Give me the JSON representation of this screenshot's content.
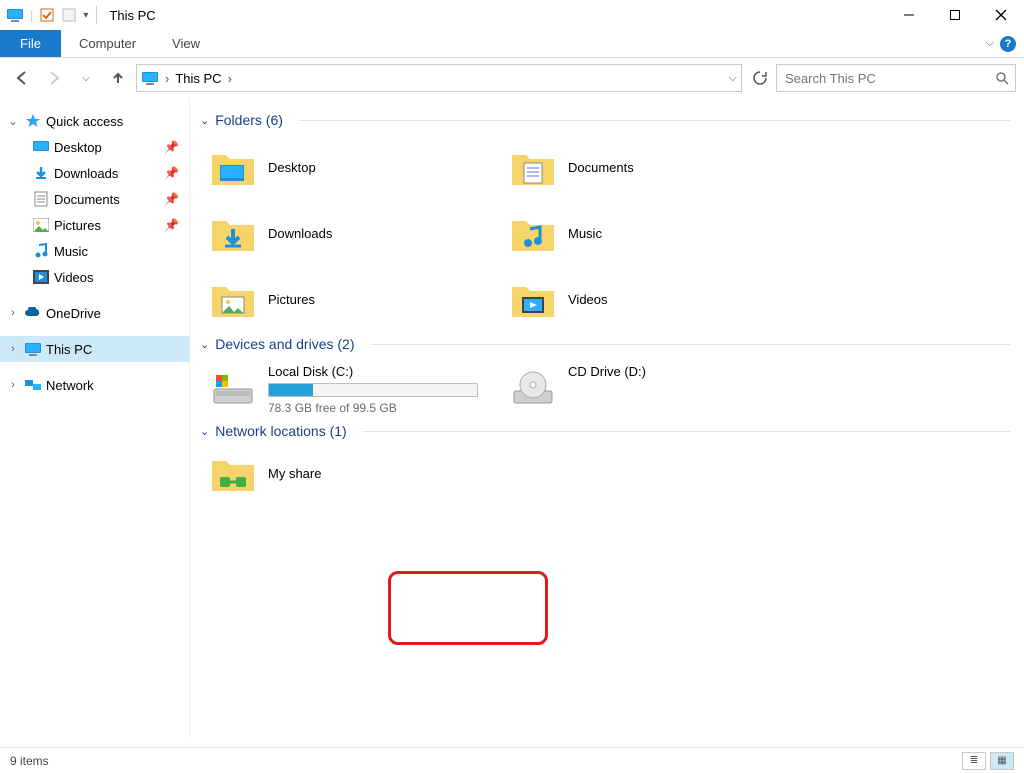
{
  "window": {
    "title": "This PC"
  },
  "ribbon": {
    "file": "File",
    "tabs": [
      "Computer",
      "View"
    ]
  },
  "address": {
    "location": "This PC",
    "search_placeholder": "Search This PC"
  },
  "sidebar": {
    "quick_access": {
      "label": "Quick access"
    },
    "quick_items": [
      {
        "label": "Desktop",
        "icon": "desktop",
        "pinned": true
      },
      {
        "label": "Downloads",
        "icon": "downloads",
        "pinned": true
      },
      {
        "label": "Documents",
        "icon": "documents",
        "pinned": true
      },
      {
        "label": "Pictures",
        "icon": "pictures",
        "pinned": true
      },
      {
        "label": "Music",
        "icon": "music",
        "pinned": false
      },
      {
        "label": "Videos",
        "icon": "videos",
        "pinned": false
      }
    ],
    "onedrive": {
      "label": "OneDrive"
    },
    "this_pc": {
      "label": "This PC"
    },
    "network": {
      "label": "Network"
    }
  },
  "groups": {
    "folders": {
      "title": "Folders (6)"
    },
    "drives": {
      "title": "Devices and drives (2)"
    },
    "network": {
      "title": "Network locations (1)"
    }
  },
  "folders": [
    {
      "label": "Desktop",
      "icon": "desktop-folder"
    },
    {
      "label": "Documents",
      "icon": "documents-folder"
    },
    {
      "label": "Downloads",
      "icon": "downloads-folder"
    },
    {
      "label": "Music",
      "icon": "music-folder"
    },
    {
      "label": "Pictures",
      "icon": "pictures-folder"
    },
    {
      "label": "Videos",
      "icon": "videos-folder"
    }
  ],
  "drives": [
    {
      "label": "Local Disk (C:)",
      "free": "78.3 GB free of 99.5 GB",
      "used_pct": 21,
      "icon": "hdd"
    },
    {
      "label": "CD Drive (D:)",
      "free": "",
      "used_pct": null,
      "icon": "cd"
    }
  ],
  "network_locations": [
    {
      "label": "My share",
      "icon": "network-share"
    }
  ],
  "status": {
    "text": "9 items"
  }
}
